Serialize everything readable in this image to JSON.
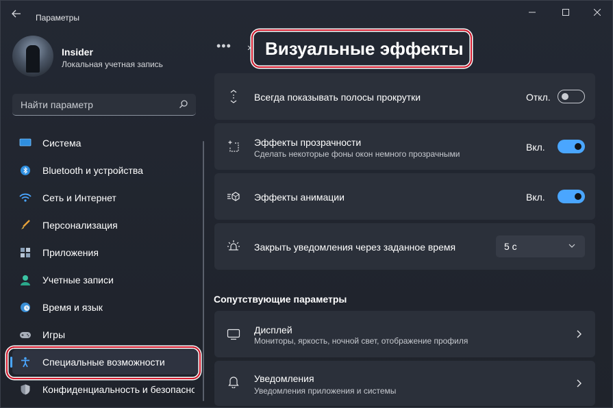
{
  "window": {
    "title": "Параметры",
    "controls": {
      "minimize": "minimize-icon",
      "maximize": "maximize-icon",
      "close": "close-icon"
    }
  },
  "user": {
    "name": "Insider",
    "account_type": "Локальная учетная запись"
  },
  "search": {
    "placeholder": "Найти параметр"
  },
  "sidebar": {
    "items": [
      {
        "label": "Система",
        "icon": "monitor-icon"
      },
      {
        "label": "Bluetooth и устройства",
        "icon": "bluetooth-icon"
      },
      {
        "label": "Сеть и Интернет",
        "icon": "wifi-icon"
      },
      {
        "label": "Персонализация",
        "icon": "brush-icon"
      },
      {
        "label": "Приложения",
        "icon": "apps-icon"
      },
      {
        "label": "Учетные записи",
        "icon": "person-icon"
      },
      {
        "label": "Время и язык",
        "icon": "globe-clock-icon"
      },
      {
        "label": "Игры",
        "icon": "gamepad-icon"
      },
      {
        "label": "Специальные возможности",
        "icon": "accessibility-icon",
        "selected": true
      },
      {
        "label": "Конфиденциальность и безопасность",
        "icon": "shield-icon"
      }
    ]
  },
  "breadcrumb": {
    "more": "•••",
    "separator": "›"
  },
  "page": {
    "title": "Визуальные эффекты"
  },
  "settings": [
    {
      "title": "Всегда показывать полосы прокрутки",
      "subtitle": "",
      "state": "Откл.",
      "on": false,
      "icon": "scrollbar-icon"
    },
    {
      "title": "Эффекты прозрачности",
      "subtitle": "Сделать некоторые фоны окон немного прозрачными",
      "state": "Вкл.",
      "on": true,
      "icon": "transparency-icon"
    },
    {
      "title": "Эффекты анимации",
      "subtitle": "",
      "state": "Вкл.",
      "on": true,
      "icon": "animation-icon"
    },
    {
      "title": "Закрыть уведомления через заданное время",
      "subtitle": "",
      "value": "5 с",
      "icon": "notification-timer-icon"
    }
  ],
  "related": {
    "title": "Сопутствующие параметры",
    "items": [
      {
        "title": "Дисплей",
        "subtitle": "Мониторы, яркость, ночной свет, отображение профиля",
        "icon": "display-icon"
      },
      {
        "title": "Уведомления",
        "subtitle": "Уведомления приложения и системы",
        "icon": "bell-icon"
      }
    ]
  },
  "colors": {
    "accent": "#4aa6ff",
    "highlight": "#d4182b",
    "card": "#2b303a"
  }
}
